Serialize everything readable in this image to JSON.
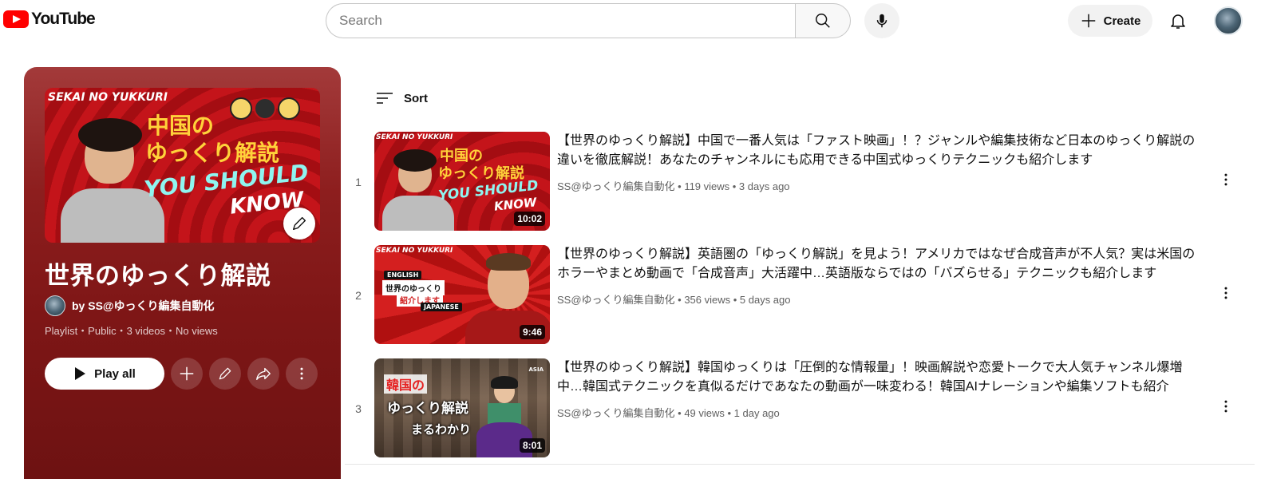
{
  "header": {
    "logo_text": "YouTube",
    "search_placeholder": "Search",
    "create_label": "Create"
  },
  "playlist": {
    "title": "世界のゆっくり解説",
    "owner": "by SS@ゆっくり編集自動化",
    "meta": "Playlist・Public・3 videos・No views",
    "play_all_label": "Play all",
    "thumb": {
      "top_text": "SEKAI NO YUKKURI",
      "line1": "中国の",
      "line2": "ゆっくり解説",
      "line3": "YOU SHOULD",
      "line4": "KNOW"
    }
  },
  "sort_label": "Sort",
  "videos": [
    {
      "index": "1",
      "title": "【世界のゆっくり解説】中国で一番人気は「ファスト映画」！？ジャンルや編集技術など日本のゆっくり解説の違いを徹底解説！あなたのチャンネルにも応用できる中国式ゆっくりテクニックも紹介します",
      "meta": "SS@ゆっくり編集自動化 • 119 views • 3 days ago",
      "duration": "10:02",
      "thumb_top": "SEKAI NO YUKKURI",
      "thumb_l1": "中国の",
      "thumb_l2": "ゆっくり解説",
      "thumb_l3": "YOU SHOULD",
      "thumb_l4": "KNOW"
    },
    {
      "index": "2",
      "title": "【世界のゆっくり解説】英語圏の「ゆっくり解説」を見よう！アメリカではなぜ合成音声が不人気？実は米国のホラーやまとめ動画で「合成音声」大活躍中…英語版ならではの「バズらせる」テクニックも紹介します",
      "meta": "SS@ゆっくり編集自動化 • 356 views • 5 days ago",
      "duration": "9:46",
      "thumb_top": "SEKAI NO YUKKURI",
      "thumb_l1": "ENGLISH",
      "thumb_l2": "世界のゆっくり",
      "thumb_l3": "紹介します",
      "thumb_l4": "JAPANESE"
    },
    {
      "index": "3",
      "title": "【世界のゆっくり解説】韓国ゆっくりは「圧倒的な情報量」！映画解説や恋愛トークで大人気チャンネル爆増中…韓国式テクニックを真似るだけであなたの動画が一味変わる！韓国AIナレーションや編集ソフトも紹介",
      "meta": "SS@ゆっくり編集自動化 • 49 views • 1 day ago",
      "duration": "8:01",
      "thumb_l1": "韓国の",
      "thumb_l2": "ゆっくり解説",
      "thumb_l3": "まるわかり",
      "thumb_corner": "ASIA"
    }
  ],
  "colors": {
    "brand_red": "#ff0000",
    "panel_red": "#8d1e1e"
  }
}
